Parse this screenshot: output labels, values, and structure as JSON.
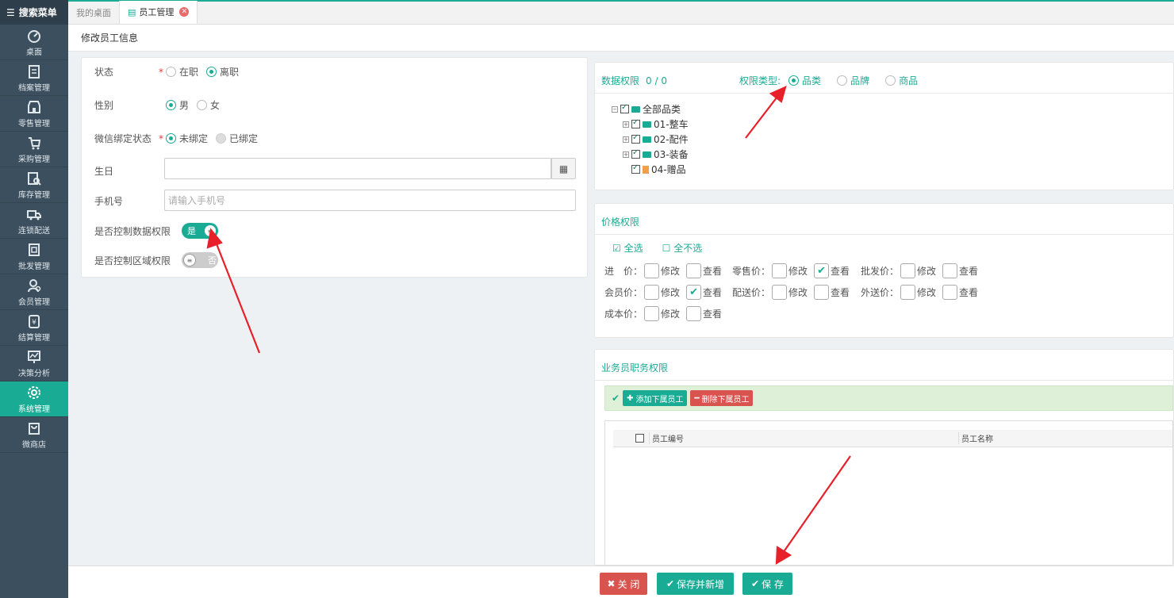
{
  "sidebar": {
    "search_label": "搜索菜单",
    "items": [
      {
        "label": "桌面",
        "icon": "dashboard-icon"
      },
      {
        "label": "档案管理",
        "icon": "archive-icon"
      },
      {
        "label": "零售管理",
        "icon": "store-icon"
      },
      {
        "label": "采购管理",
        "icon": "cart-icon"
      },
      {
        "label": "库存管理",
        "icon": "inventory-search-icon"
      },
      {
        "label": "连锁配送",
        "icon": "truck-icon"
      },
      {
        "label": "批发管理",
        "icon": "wholesale-icon"
      },
      {
        "label": "会员管理",
        "icon": "member-icon"
      },
      {
        "label": "结算管理",
        "icon": "settlement-icon"
      },
      {
        "label": "决策分析",
        "icon": "analysis-icon"
      },
      {
        "label": "系统管理",
        "icon": "gear-icon",
        "active": true
      },
      {
        "label": "微商店",
        "icon": "shop-bag-icon"
      }
    ]
  },
  "tabs": [
    {
      "label": "我的桌面"
    },
    {
      "label": "员工管理",
      "active": true
    }
  ],
  "page_title": "修改员工信息",
  "form": {
    "status": {
      "label": "状态",
      "required": "*",
      "options": [
        "在职",
        "离职"
      ],
      "selected": "离职"
    },
    "gender": {
      "label": "性别",
      "options": [
        "男",
        "女"
      ],
      "selected": "男"
    },
    "wechat": {
      "label": "微信绑定状态",
      "required": "*",
      "options": [
        "未绑定",
        "已绑定"
      ],
      "selected": "未绑定"
    },
    "birthday": {
      "label": "生日",
      "value": ""
    },
    "phone": {
      "label": "手机号",
      "placeholder": "请输入手机号"
    },
    "data_perm_ctrl": {
      "label": "是否控制数据权限",
      "toggle_text": "是",
      "on": true
    },
    "area_perm_ctrl": {
      "label": "是否控制区域权限",
      "toggle_text": "否",
      "on": false
    }
  },
  "data_perm": {
    "title": "数据权限",
    "count": "0 / 0",
    "type_label": "权限类型:",
    "types": [
      "品类",
      "品牌",
      "商品"
    ],
    "selected_type": "品类",
    "tree": {
      "root": "全部品类",
      "children": [
        "01-整车",
        "02-配件",
        "03-装备",
        "04-赠品"
      ]
    }
  },
  "price_perm": {
    "title": "价格权限",
    "select_all": "全选",
    "select_none": "全不选",
    "edit_label": "修改",
    "view_label": "查看",
    "rows": [
      [
        {
          "label": "进　价：",
          "edit": false,
          "view": false
        },
        {
          "label": "零售价：",
          "edit": false,
          "view": true
        },
        {
          "label": "批发价：",
          "edit": false,
          "view": false
        }
      ],
      [
        {
          "label": "会员价：",
          "edit": false,
          "view": true
        },
        {
          "label": "配送价：",
          "edit": false,
          "view": false
        },
        {
          "label": "外送价：",
          "edit": false,
          "view": false
        }
      ],
      [
        {
          "label": "成本价：",
          "edit": false,
          "view": false
        }
      ]
    ]
  },
  "biz_perm": {
    "title": "业务员职务权限",
    "add_btn": "添加下属员工",
    "del_btn": "删除下属员工",
    "columns": [
      "员工编号",
      "员工名称"
    ]
  },
  "footer": {
    "close": "关 闭",
    "save_new": "保存并新增",
    "save": "保 存"
  },
  "colors": {
    "accent": "#1aab94",
    "danger": "#d9534f",
    "sidebar": "#3c4f5e",
    "arrow": "#e8202a"
  }
}
